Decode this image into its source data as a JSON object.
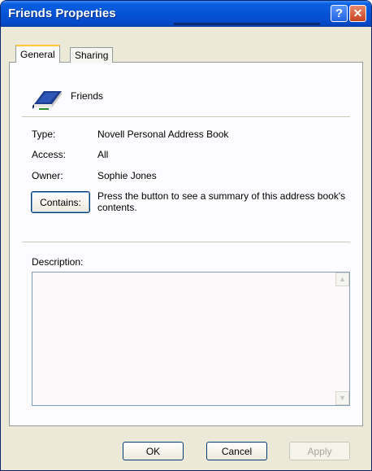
{
  "window": {
    "title": "Friends Properties"
  },
  "tabs": [
    {
      "label": "General",
      "active": true
    },
    {
      "label": "Sharing",
      "active": false
    }
  ],
  "book": {
    "name": "Friends",
    "icon": "address-book-icon"
  },
  "properties": [
    {
      "label": "Type:",
      "value": "Novell Personal Address Book"
    },
    {
      "label": "Access:",
      "value": "All"
    },
    {
      "label": "Owner:",
      "value": "Sophie Jones"
    }
  ],
  "contains": {
    "button_label": "Contains:",
    "text": "Press the button to see a summary of this address book's contents."
  },
  "description": {
    "label": "Description:",
    "value": ""
  },
  "buttons": {
    "ok": "OK",
    "cancel": "Cancel",
    "apply": "Apply"
  },
  "title_buttons": {
    "help": "?",
    "close": "✕"
  },
  "colors": {
    "titlebar": "#0554d6",
    "dialog": "#ece9d8",
    "panel": "#fcfcfe",
    "tab_highlight": "#ffc83c"
  }
}
